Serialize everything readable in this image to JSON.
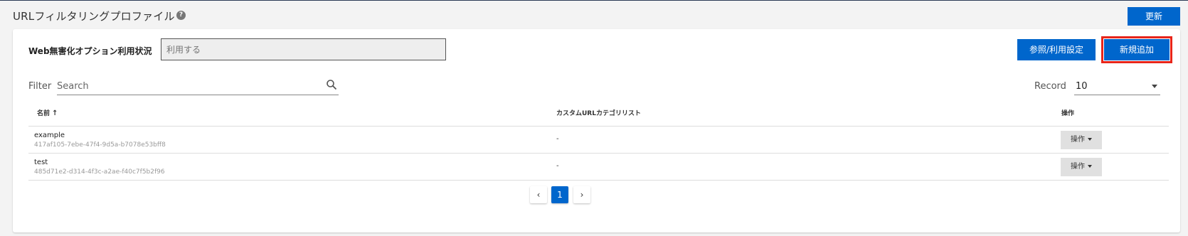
{
  "header": {
    "title": "URLフィルタリングプロファイル",
    "help_icon": "question-circle-icon",
    "refresh_label": "更新"
  },
  "option": {
    "label": "Web無害化オプション利用状況",
    "value_placeholder": "利用する"
  },
  "toolbar": {
    "ref_label": "参照/利用設定",
    "add_label": "新規追加"
  },
  "filter": {
    "label": "Filter",
    "placeholder": "Search",
    "icon": "search-icon"
  },
  "record": {
    "label": "Record",
    "value": "10"
  },
  "table": {
    "columns": {
      "name": "名前",
      "category": "カスタムURLカテゴリリスト",
      "ops": "操作"
    },
    "rows": [
      {
        "name": "example",
        "id": "417af105-7ebe-47f4-9d5a-b7078e53bff8",
        "category": "-",
        "ops_label": "操作"
      },
      {
        "name": "test",
        "id": "485d71e2-d314-4f3c-a2ae-f40c7f5b2f96",
        "category": "-",
        "ops_label": "操作"
      }
    ]
  },
  "pagination": {
    "prev": "‹",
    "current": "1",
    "next": "›"
  },
  "colors": {
    "primary": "#0066cc",
    "highlight": "#e8251a"
  }
}
